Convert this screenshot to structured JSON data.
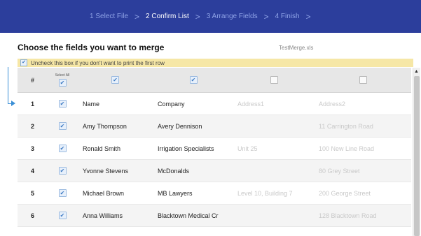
{
  "wizard": {
    "steps": [
      "1 Select File",
      "2 Confirm List",
      "3 Arrange Fields",
      "4 Finish"
    ],
    "separator": ">"
  },
  "heading": "Choose the fields you want to merge",
  "filename": "TestMerge.xls",
  "notice": "Uncheck this box if you don't want to print the first row",
  "table": {
    "header": {
      "num": "#",
      "select_all": "Select All"
    },
    "rows": [
      {
        "num": "1",
        "a": "Name",
        "b": "Company",
        "c": "Address1",
        "d": "Address2"
      },
      {
        "num": "2",
        "a": "Amy Thompson",
        "b": "Avery Dennison",
        "c": "",
        "d": "11 Carrington Road"
      },
      {
        "num": "3",
        "a": "Ronald Smith",
        "b": "Irrigation Specialists",
        "c": "Unit 25",
        "d": "100 New Line Road"
      },
      {
        "num": "4",
        "a": "Yvonne Stevens",
        "b": "McDonalds",
        "c": "",
        "d": "80 Grey Street"
      },
      {
        "num": "5",
        "a": "Michael Brown",
        "b": "MB Lawyers",
        "c": "Level 10, Building 7",
        "d": "200 George Street"
      },
      {
        "num": "6",
        "a": "Anna Williams",
        "b": "Blacktown Medical Cr",
        "c": "",
        "d": "128 Blacktown Road"
      }
    ]
  },
  "colors": {
    "wizard_bg": "#2c3e9c",
    "notice_bg": "#f6e7a6",
    "check_blue": "#3a78c2"
  }
}
